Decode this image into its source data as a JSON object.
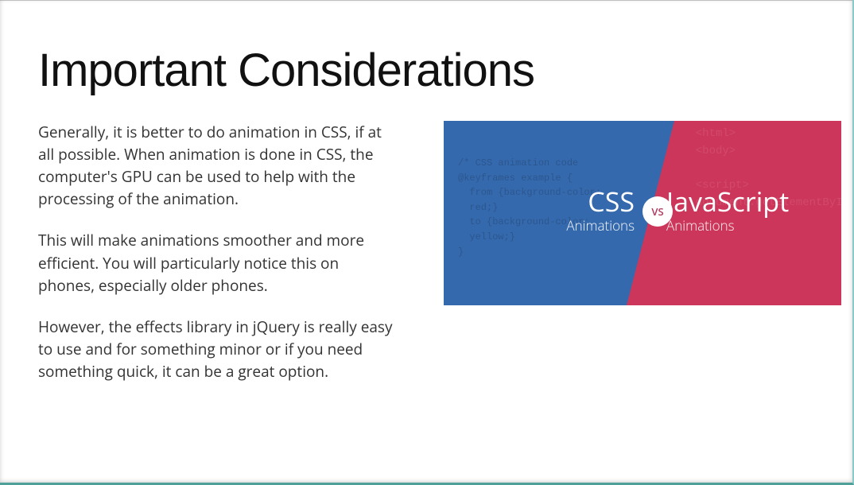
{
  "slide": {
    "title": "Important Considerations",
    "paragraphs": [
      "Generally, it is better to do animation in CSS, if at all possible. When animation is done in CSS, the computer's GPU can be used to help with the processing of the animation.",
      "This will make animations smoother and more efficient. You will particularly notice this on phones, especially older phones.",
      "However, the effects library in jQuery is really easy to use and for something minor or if you need something quick, it can be a great option."
    ]
  },
  "graphic": {
    "left_title": "CSS",
    "left_subtitle": "Animations",
    "right_title": "JavaScript",
    "right_subtitle": "Animations",
    "vs": "VS",
    "ghost_blue": "/* CSS animation code\n@keyframes example {\n  from {background-color:\n  red;}\n  to {background-color:\n  yellow;}\n}",
    "ghost_red": "<html>\n<body>\n\n<script>\ndocument.getElementById",
    "colors": {
      "blue": "#3569ad",
      "red": "#cc365a",
      "white": "#ffffff"
    }
  }
}
